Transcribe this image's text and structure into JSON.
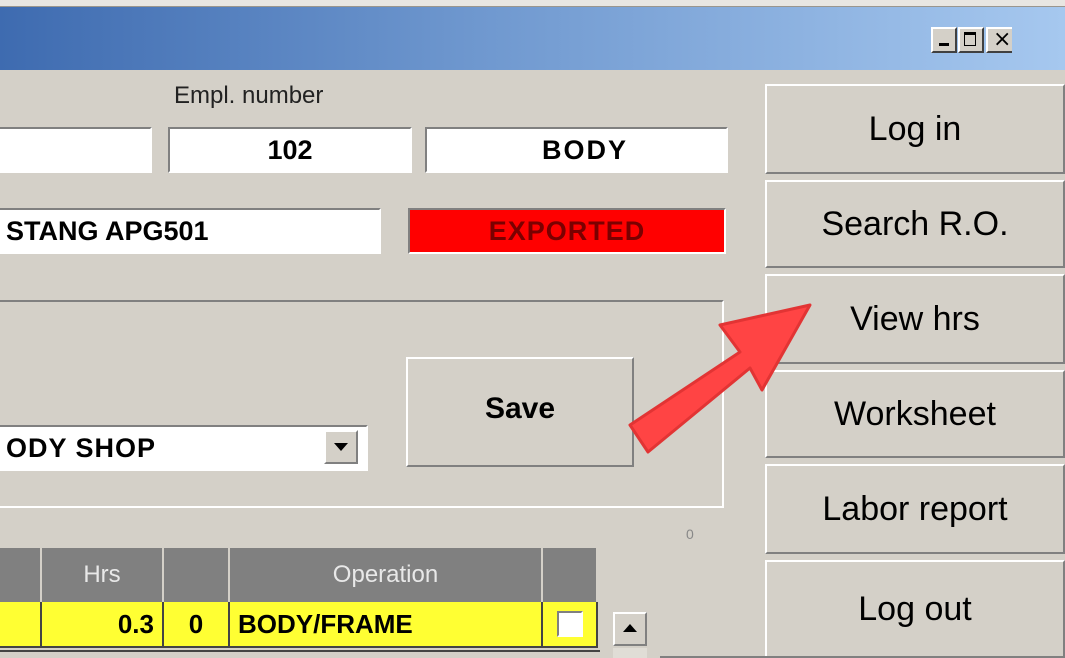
{
  "window": {
    "controls": {
      "minimize_icon": "_",
      "maximize_icon": "☐",
      "close_icon": "×"
    }
  },
  "employee": {
    "label": "Empl. number",
    "name_value": "",
    "number_value": "102",
    "department_value": "BODY"
  },
  "vehicle": {
    "value": "STANG APG501"
  },
  "status": {
    "value": "EXPORTED",
    "color": "#ff0000"
  },
  "shop_select": {
    "value": "ODY SHOP"
  },
  "save_button": {
    "label": "Save"
  },
  "counter": {
    "value": "0"
  },
  "sidebar": {
    "buttons": [
      {
        "label": "Log in"
      },
      {
        "label": "Search R.O."
      },
      {
        "label": "View hrs"
      },
      {
        "label": "Worksheet"
      },
      {
        "label": "Labor report"
      },
      {
        "label": "Log out"
      }
    ]
  },
  "table": {
    "headers": [
      "",
      "Hrs",
      "",
      "Operation",
      ""
    ],
    "rows": [
      {
        "col0": "",
        "hrs": "0.3",
        "flag": "0",
        "operation": "BODY/FRAME",
        "checked": false
      }
    ],
    "row_color": "#ffff33"
  },
  "annotation": {
    "arrow_color": "#ff4444"
  }
}
